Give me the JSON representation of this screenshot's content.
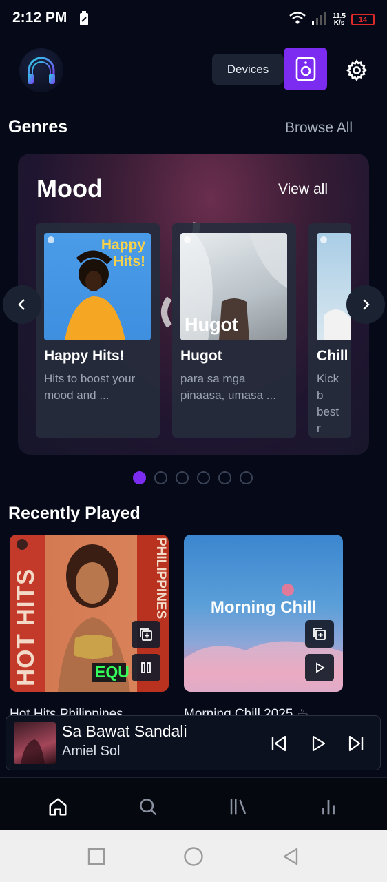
{
  "status_bar": {
    "time": "2:12 PM",
    "net_speed_value": "11.5",
    "net_speed_unit": "K/s",
    "battery": "14",
    "battery_color": "#e02a2a"
  },
  "header": {
    "devices_label": "Devices",
    "accent_color": "#7c2cf0"
  },
  "genres": {
    "title": "Genres",
    "browse_all": "Browse All",
    "card": {
      "title": "Mood",
      "view_all": "View all",
      "items": [
        {
          "title": "Happy Hits!",
          "description": "Hits to boost your mood and ...",
          "art_text": "Happy Hits!"
        },
        {
          "title": "Hugot",
          "description": "para sa mga pinaasa, umasa ...",
          "art_text": "Hugot"
        },
        {
          "title": "Chill",
          "description": "Kick b best r"
        }
      ]
    },
    "page_count": 6,
    "active_page": 0
  },
  "recently_played": {
    "title": "Recently Played",
    "items": [
      {
        "title": "Hot Hits Philippines",
        "art_text_left": "HOT HITS",
        "art_text_right": "PHILIPPINES",
        "badge": "EQU",
        "state": "playing"
      },
      {
        "title": "Morning Chill 2025 ☕",
        "art_text": "Morning Chill",
        "state": "paused"
      }
    ]
  },
  "now_playing": {
    "title": "Sa Bawat Sandali",
    "artist": "Amiel Sol"
  },
  "bottom_nav": {
    "items": [
      "home-icon",
      "search-icon",
      "library-icon",
      "stats-icon"
    ]
  }
}
